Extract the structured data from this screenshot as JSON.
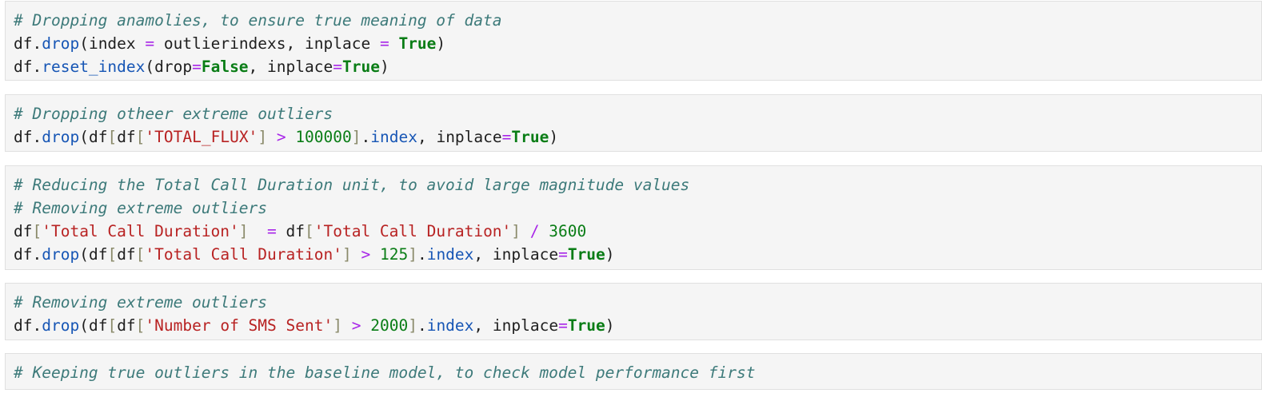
{
  "cells": [
    {
      "lines": [
        [
          {
            "t": "c",
            "v": "# Dropping anamolies, to ensure true meaning of data"
          }
        ],
        [
          {
            "t": "v",
            "v": "df"
          },
          {
            "t": "p",
            "v": "."
          },
          {
            "t": "m",
            "v": "drop"
          },
          {
            "t": "p",
            "v": "("
          },
          {
            "t": "v",
            "v": "index "
          },
          {
            "t": "o",
            "v": "="
          },
          {
            "t": "v",
            "v": " outlierindexs"
          },
          {
            "t": "p",
            "v": ", "
          },
          {
            "t": "v",
            "v": "inplace "
          },
          {
            "t": "o",
            "v": "="
          },
          {
            "t": "v",
            "v": " "
          },
          {
            "t": "k",
            "v": "True"
          },
          {
            "t": "p",
            "v": ")"
          }
        ],
        [
          {
            "t": "v",
            "v": "df"
          },
          {
            "t": "p",
            "v": "."
          },
          {
            "t": "m",
            "v": "reset_index"
          },
          {
            "t": "p",
            "v": "("
          },
          {
            "t": "v",
            "v": "drop"
          },
          {
            "t": "o",
            "v": "="
          },
          {
            "t": "k",
            "v": "False"
          },
          {
            "t": "p",
            "v": ", "
          },
          {
            "t": "v",
            "v": "inplace"
          },
          {
            "t": "o",
            "v": "="
          },
          {
            "t": "k",
            "v": "True"
          },
          {
            "t": "p",
            "v": ")"
          }
        ]
      ]
    },
    {
      "lines": [
        [
          {
            "t": "c",
            "v": "# Dropping otheer extreme outliers"
          }
        ],
        [
          {
            "t": "v",
            "v": "df"
          },
          {
            "t": "p",
            "v": "."
          },
          {
            "t": "m",
            "v": "drop"
          },
          {
            "t": "p",
            "v": "("
          },
          {
            "t": "v",
            "v": "df"
          },
          {
            "t": "b",
            "v": "["
          },
          {
            "t": "v",
            "v": "df"
          },
          {
            "t": "b",
            "v": "["
          },
          {
            "t": "s",
            "v": "'TOTAL_FLUX'"
          },
          {
            "t": "b",
            "v": "]"
          },
          {
            "t": "v",
            "v": " "
          },
          {
            "t": "o",
            "v": ">"
          },
          {
            "t": "v",
            "v": " "
          },
          {
            "t": "n",
            "v": "100000"
          },
          {
            "t": "b",
            "v": "]"
          },
          {
            "t": "p",
            "v": "."
          },
          {
            "t": "m",
            "v": "index"
          },
          {
            "t": "p",
            "v": ", "
          },
          {
            "t": "v",
            "v": "inplace"
          },
          {
            "t": "o",
            "v": "="
          },
          {
            "t": "k",
            "v": "True"
          },
          {
            "t": "p",
            "v": ")"
          }
        ]
      ]
    },
    {
      "lines": [
        [
          {
            "t": "c",
            "v": "# Reducing the Total Call Duration unit, to avoid large magnitude values"
          }
        ],
        [
          {
            "t": "c",
            "v": "# Removing extreme outliers"
          }
        ],
        [
          {
            "t": "v",
            "v": "df"
          },
          {
            "t": "b",
            "v": "["
          },
          {
            "t": "s",
            "v": "'Total Call Duration'"
          },
          {
            "t": "b",
            "v": "]"
          },
          {
            "t": "v",
            "v": "  "
          },
          {
            "t": "o",
            "v": "="
          },
          {
            "t": "v",
            "v": " df"
          },
          {
            "t": "b",
            "v": "["
          },
          {
            "t": "s",
            "v": "'Total Call Duration'"
          },
          {
            "t": "b",
            "v": "]"
          },
          {
            "t": "v",
            "v": " "
          },
          {
            "t": "o",
            "v": "/"
          },
          {
            "t": "v",
            "v": " "
          },
          {
            "t": "n",
            "v": "3600"
          }
        ],
        [
          {
            "t": "v",
            "v": "df"
          },
          {
            "t": "p",
            "v": "."
          },
          {
            "t": "m",
            "v": "drop"
          },
          {
            "t": "p",
            "v": "("
          },
          {
            "t": "v",
            "v": "df"
          },
          {
            "t": "b",
            "v": "["
          },
          {
            "t": "v",
            "v": "df"
          },
          {
            "t": "b",
            "v": "["
          },
          {
            "t": "s",
            "v": "'Total Call Duration'"
          },
          {
            "t": "b",
            "v": "]"
          },
          {
            "t": "v",
            "v": " "
          },
          {
            "t": "o",
            "v": ">"
          },
          {
            "t": "v",
            "v": " "
          },
          {
            "t": "n",
            "v": "125"
          },
          {
            "t": "b",
            "v": "]"
          },
          {
            "t": "p",
            "v": "."
          },
          {
            "t": "m",
            "v": "index"
          },
          {
            "t": "p",
            "v": ", "
          },
          {
            "t": "v",
            "v": "inplace"
          },
          {
            "t": "o",
            "v": "="
          },
          {
            "t": "k",
            "v": "True"
          },
          {
            "t": "p",
            "v": ")"
          }
        ]
      ]
    },
    {
      "lines": [
        [
          {
            "t": "c",
            "v": "# Removing extreme outliers"
          }
        ],
        [
          {
            "t": "v",
            "v": "df"
          },
          {
            "t": "p",
            "v": "."
          },
          {
            "t": "m",
            "v": "drop"
          },
          {
            "t": "p",
            "v": "("
          },
          {
            "t": "v",
            "v": "df"
          },
          {
            "t": "b",
            "v": "["
          },
          {
            "t": "v",
            "v": "df"
          },
          {
            "t": "b",
            "v": "["
          },
          {
            "t": "s",
            "v": "'Number of SMS Sent'"
          },
          {
            "t": "b",
            "v": "]"
          },
          {
            "t": "v",
            "v": " "
          },
          {
            "t": "o",
            "v": ">"
          },
          {
            "t": "v",
            "v": " "
          },
          {
            "t": "n",
            "v": "2000"
          },
          {
            "t": "b",
            "v": "]"
          },
          {
            "t": "p",
            "v": "."
          },
          {
            "t": "m",
            "v": "index"
          },
          {
            "t": "p",
            "v": ", "
          },
          {
            "t": "v",
            "v": "inplace"
          },
          {
            "t": "o",
            "v": "="
          },
          {
            "t": "k",
            "v": "True"
          },
          {
            "t": "p",
            "v": ")"
          }
        ]
      ]
    },
    {
      "lines": [
        [
          {
            "t": "c",
            "v": "# Keeping true outliers in the baseline model, to check model performance first"
          }
        ]
      ]
    }
  ]
}
